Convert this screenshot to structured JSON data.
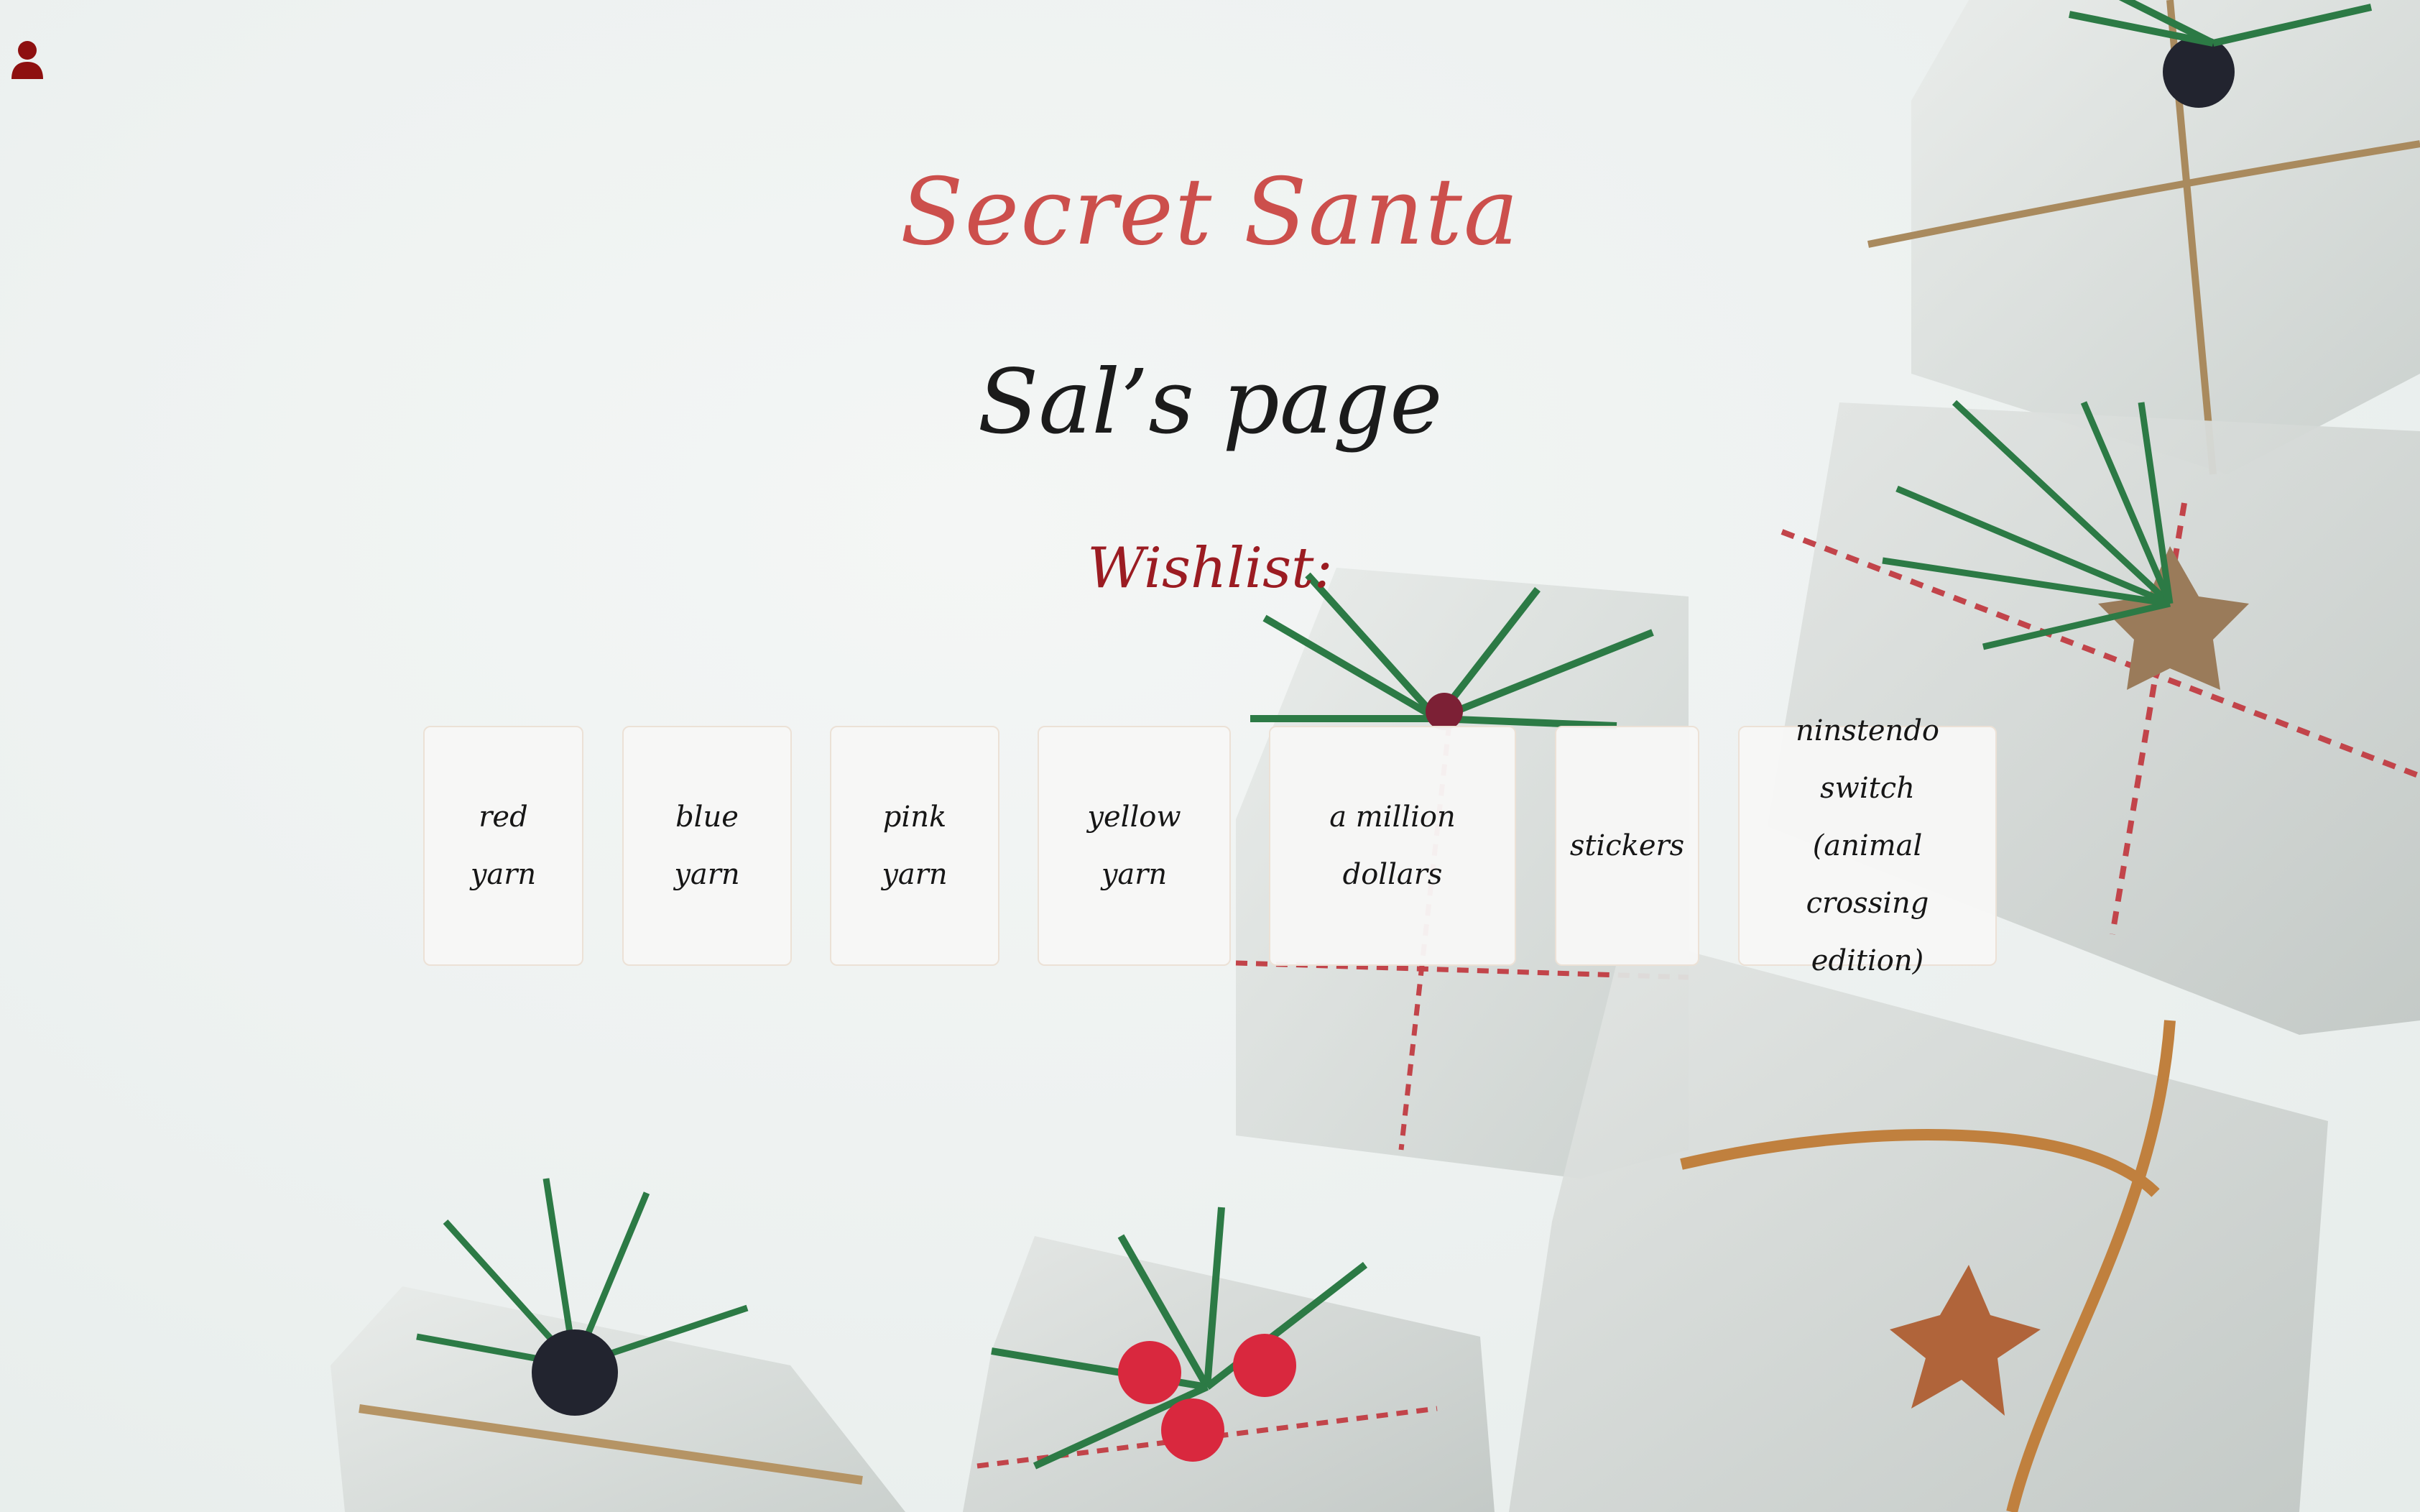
{
  "header": {
    "brand": "Secret Santa",
    "user_icon": "user-icon"
  },
  "page": {
    "title": "Sal’s page",
    "wishlist_label": "Wishlist:"
  },
  "wishlist": {
    "items": [
      {
        "label": "red yarn"
      },
      {
        "label": "blue yarn"
      },
      {
        "label": "pink yarn"
      },
      {
        "label": "yellow yarn"
      },
      {
        "label": "a million dollars"
      },
      {
        "label": "stickers"
      },
      {
        "label": "ninstendo switch (animal crossing edition)"
      }
    ]
  },
  "colors": {
    "brand": "#cc4f4c",
    "title": "#1b1b1b",
    "wishlist_label": "#9b1c22",
    "user_icon": "#8e1010",
    "card_background": "#f7f7f6",
    "card_border": "#ece1d6"
  }
}
